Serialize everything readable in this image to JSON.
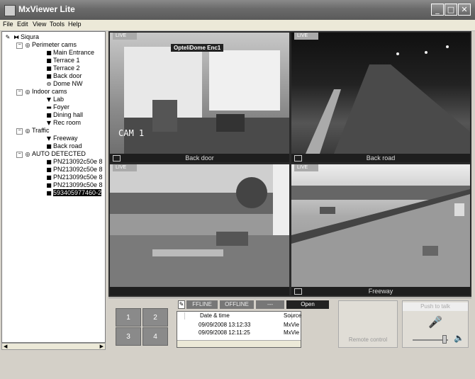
{
  "window": {
    "title": "MxViewer Lite",
    "minimize": "_",
    "maximize": "□",
    "close": "✕"
  },
  "menu": [
    "File",
    "Edit",
    "View",
    "Tools",
    "Help"
  ],
  "tree": {
    "root": "Siqura",
    "groups": [
      {
        "label": "Perimeter cams",
        "items": [
          "Main Entrance",
          "Terrace 1",
          "Terrace 2",
          "Back door",
          "Dome NW"
        ]
      },
      {
        "label": "Indoor cams",
        "items": [
          "Lab",
          "Foyer",
          "Dining hall",
          "Rec room"
        ]
      },
      {
        "label": "Traffic",
        "items": [
          "Freeway",
          "Back road"
        ]
      },
      {
        "label": "AUTO DETECTED",
        "items": [
          "PN213092c50e 8",
          "PN213092c50e 8",
          "PN213099c50e 8",
          "PN213099c50e 8",
          "5934059774​60-2"
        ]
      }
    ]
  },
  "cameras": [
    {
      "live": "LIVE",
      "overlay": "OpteliDome Enc1",
      "stamp": "CAM 1",
      "caption": "Back door"
    },
    {
      "live": "LIVE",
      "caption": "Back road"
    },
    {
      "live": "LIVE",
      "caption": ""
    },
    {
      "live": "LIVE",
      "caption": "Freeway"
    }
  ],
  "layout_buttons": [
    "1",
    "2",
    "3",
    "4"
  ],
  "tabs": {
    "offline1": "FFLINE",
    "offline2": "OFFLINE",
    "dash": "---",
    "open": "Open"
  },
  "events": {
    "headers": [
      "Date & time",
      "Source"
    ],
    "rows": [
      {
        "time": "09/09/2008 13:12:33",
        "source": "MxView"
      },
      {
        "time": "09/09/2008 12:11:25",
        "source": "MxView"
      }
    ]
  },
  "remote_control": "Remote control",
  "push_to_talk": "Push to talk",
  "colors": {
    "titlebar": "#6a6a6a",
    "selection": "#000000",
    "video_bg": "#2a2a2a"
  }
}
